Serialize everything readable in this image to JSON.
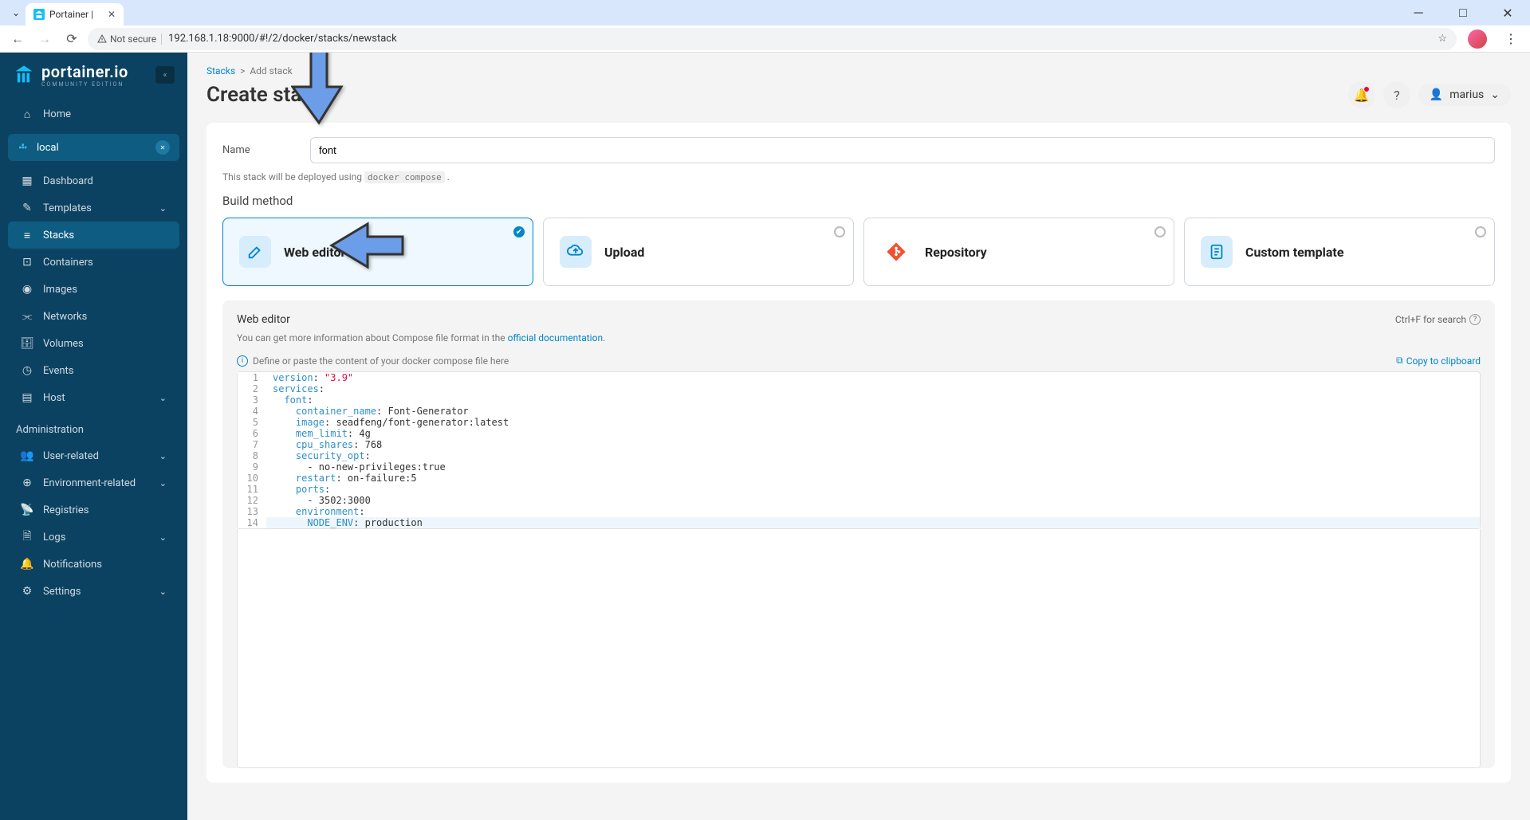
{
  "browser": {
    "tab_title": "Portainer |",
    "not_secure": "Not secure",
    "url": "192.168.1.18:9000/#!/2/docker/stacks/newstack"
  },
  "logo": {
    "title": "portainer.io",
    "subtitle": "COMMUNITY EDITION"
  },
  "nav": {
    "home": "Home",
    "env": "local",
    "items": [
      {
        "icon": "grid",
        "label": "Dashboard"
      },
      {
        "icon": "edit",
        "label": "Templates",
        "chevron": true
      },
      {
        "icon": "layers",
        "label": "Stacks",
        "active": true
      },
      {
        "icon": "box",
        "label": "Containers"
      },
      {
        "icon": "disc",
        "label": "Images"
      },
      {
        "icon": "share",
        "label": "Networks"
      },
      {
        "icon": "db",
        "label": "Volumes"
      },
      {
        "icon": "clock",
        "label": "Events"
      },
      {
        "icon": "server",
        "label": "Host",
        "chevron": true
      }
    ],
    "admin_header": "Administration",
    "admin_items": [
      {
        "icon": "users",
        "label": "User-related",
        "chevron": true
      },
      {
        "icon": "globe",
        "label": "Environment-related",
        "chevron": true
      },
      {
        "icon": "radio",
        "label": "Registries"
      },
      {
        "icon": "file",
        "label": "Logs",
        "chevron": true
      },
      {
        "icon": "bell",
        "label": "Notifications"
      },
      {
        "icon": "gear",
        "label": "Settings",
        "chevron": true
      }
    ]
  },
  "breadcrumb": {
    "root": "Stacks",
    "current": "Add stack"
  },
  "page_title": "Create stack",
  "user": "marius",
  "form": {
    "name_label": "Name",
    "name_value": "font",
    "hint_pre": "This stack will be deployed using ",
    "hint_code": "docker compose",
    "build_method_title": "Build method"
  },
  "methods": {
    "web_editor": "Web editor",
    "upload": "Upload",
    "repository": "Repository",
    "custom_template": "Custom template"
  },
  "editor": {
    "title": "Web editor",
    "search_hint": "Ctrl+F for search",
    "info_pre": "You can get more information about Compose file format in the ",
    "info_link": "official documentation",
    "placeholder_hint": "Define or paste the content of your docker compose file here",
    "copy": "Copy to clipboard",
    "lines": [
      [
        {
          "t": "version",
          "c": "kw"
        },
        {
          "t": ": ",
          "c": ""
        },
        {
          "t": "\"3.9\"",
          "c": "str"
        }
      ],
      [
        {
          "t": "services",
          "c": "kw"
        },
        {
          "t": ":",
          "c": ""
        }
      ],
      [
        {
          "t": "  font",
          "c": "kw"
        },
        {
          "t": ":",
          "c": ""
        }
      ],
      [
        {
          "t": "    container_name",
          "c": "kw"
        },
        {
          "t": ": Font-Generator",
          "c": "val"
        }
      ],
      [
        {
          "t": "    image",
          "c": "kw"
        },
        {
          "t": ": seadfeng/font-generator:latest",
          "c": "val"
        }
      ],
      [
        {
          "t": "    mem_limit",
          "c": "kw"
        },
        {
          "t": ": 4g",
          "c": "val"
        }
      ],
      [
        {
          "t": "    cpu_shares",
          "c": "kw"
        },
        {
          "t": ": 768",
          "c": "val"
        }
      ],
      [
        {
          "t": "    security_opt",
          "c": "kw"
        },
        {
          "t": ":",
          "c": ""
        }
      ],
      [
        {
          "t": "      - no-new-privileges:true",
          "c": "val"
        }
      ],
      [
        {
          "t": "    restart",
          "c": "kw"
        },
        {
          "t": ": on-failure:5",
          "c": "val"
        }
      ],
      [
        {
          "t": "    ports",
          "c": "kw"
        },
        {
          "t": ":",
          "c": ""
        }
      ],
      [
        {
          "t": "      - 3502:3000",
          "c": "val"
        }
      ],
      [
        {
          "t": "    environment",
          "c": "kw"
        },
        {
          "t": ":",
          "c": ""
        }
      ],
      [
        {
          "t": "      NODE_ENV",
          "c": "kw"
        },
        {
          "t": ": production",
          "c": "val"
        }
      ]
    ]
  }
}
